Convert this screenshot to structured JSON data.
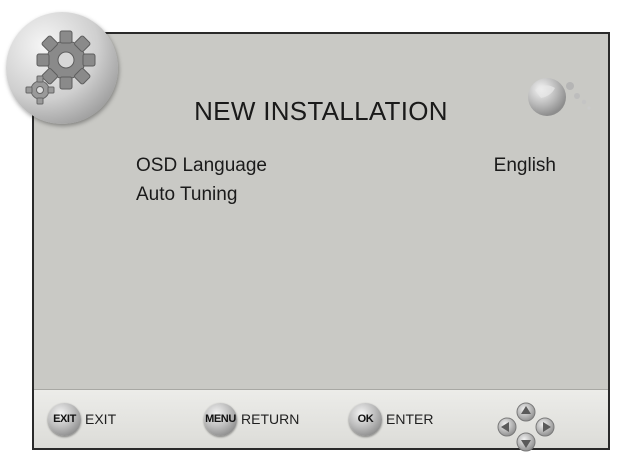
{
  "screen": {
    "title": "NEW INSTALLATION",
    "icons": {
      "badge": "gear-icon",
      "decoration": "globe-icon"
    },
    "menu": [
      {
        "label": "OSD Language",
        "value": "English"
      },
      {
        "label": "Auto Tuning",
        "value": ""
      }
    ]
  },
  "footer": {
    "exit": {
      "key": "EXIT",
      "label": "EXIT"
    },
    "return": {
      "key": "MENU",
      "label": "RETURN"
    },
    "enter": {
      "key": "OK",
      "label": "ENTER"
    },
    "nav_icon": "arrow-keys-icon"
  },
  "colors": {
    "panel": "#c9c9c5",
    "footer": "#e6e6e3",
    "text": "#1a1a1a",
    "border": "#2a2a2a"
  }
}
